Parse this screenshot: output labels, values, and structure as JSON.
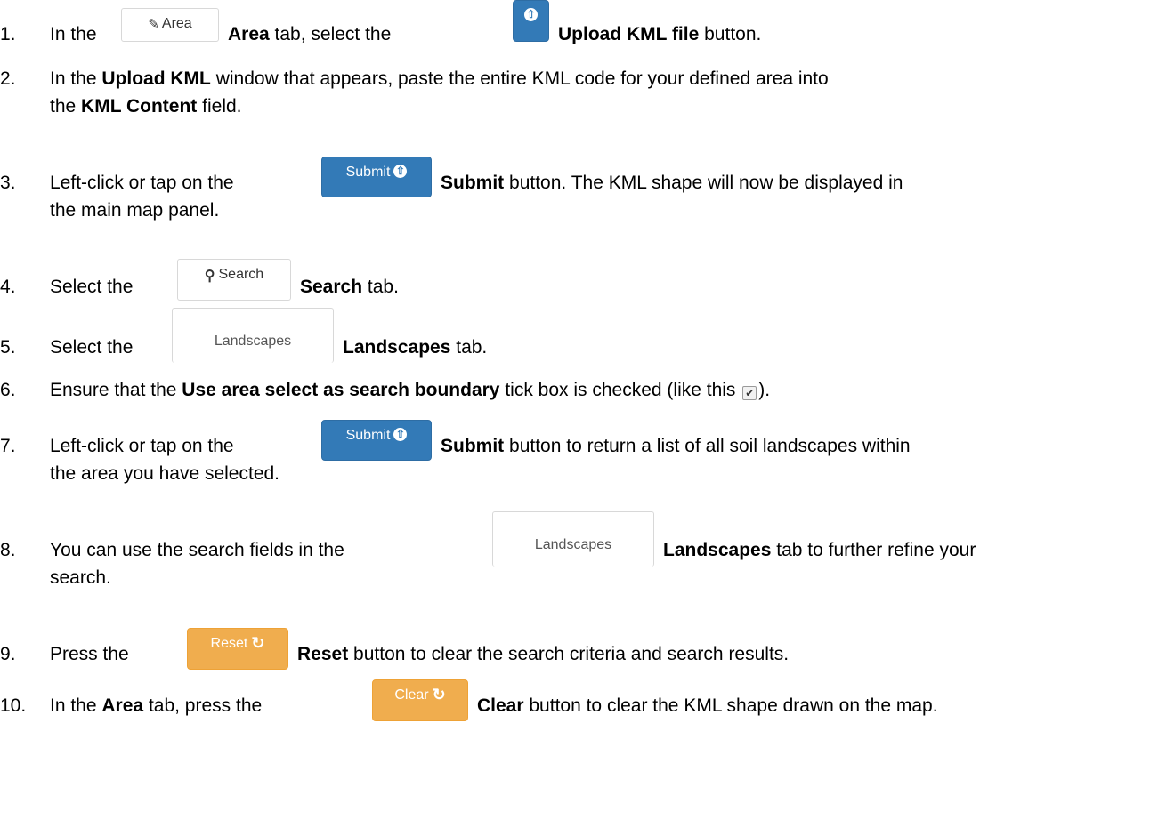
{
  "steps": [
    {
      "num": "1.",
      "pre": "In the",
      "b1": "Area",
      "mid": "tab, select the",
      "b2": "Upload KML file",
      "post": "button."
    },
    {
      "num": "2.",
      "pre": "In the",
      "b1": "Upload KML",
      "mid": "window that appears, paste the entire KML code for your defined area into",
      "line2_pre": "the",
      "b2": "KML Content",
      "post": "field."
    },
    {
      "num": "3.",
      "pre": "Left-click or tap on the",
      "b1": "Submit",
      "mid": "button. The KML shape will now be displayed in",
      "line2": "the main map panel."
    },
    {
      "num": "4.",
      "pre": "Select the",
      "b1": "Search",
      "post": "tab."
    },
    {
      "num": "5.",
      "pre": "Select the",
      "b1": "Landscapes",
      "post": "tab."
    },
    {
      "num": "6.",
      "pre": "Ensure that the",
      "b1": "Use area select as search boundary",
      "mid": "tick box is checked (like this",
      "post": ")."
    },
    {
      "num": "7.",
      "pre": "Left-click or tap on the",
      "b1": "Submit",
      "mid": "button to return a list of all soil landscapes within",
      "line2": "the area you have selected."
    },
    {
      "num": "8.",
      "pre": "You can use the search fields in the",
      "b1": "Landscapes",
      "mid": "tab to further refine your",
      "line2": "search."
    },
    {
      "num": "9.",
      "pre": "Press the",
      "b1": "Reset",
      "post": "button to clear the search criteria and search results."
    },
    {
      "num": "10.",
      "pre": "In the",
      "b1": "Area",
      "mid": "tab, press the",
      "b2": "Clear",
      "post": "button to clear the KML shape drawn on the map."
    }
  ],
  "buttons": {
    "area_tab": "Area",
    "upload_kml": "",
    "submit": "Submit",
    "search_tab": "Search",
    "landscapes_tab": "Landscapes",
    "reset": "Reset",
    "clear": "Clear"
  },
  "icons": {
    "area": "edit-icon",
    "upload": "circle-arrow-up-icon",
    "search": "magnifier-icon",
    "refresh": "refresh-icon",
    "tick": "checkmark-icon"
  },
  "colors": {
    "primary": "#337ab7",
    "warning": "#f0ad4e",
    "tab_border": "#d8d8d8"
  }
}
